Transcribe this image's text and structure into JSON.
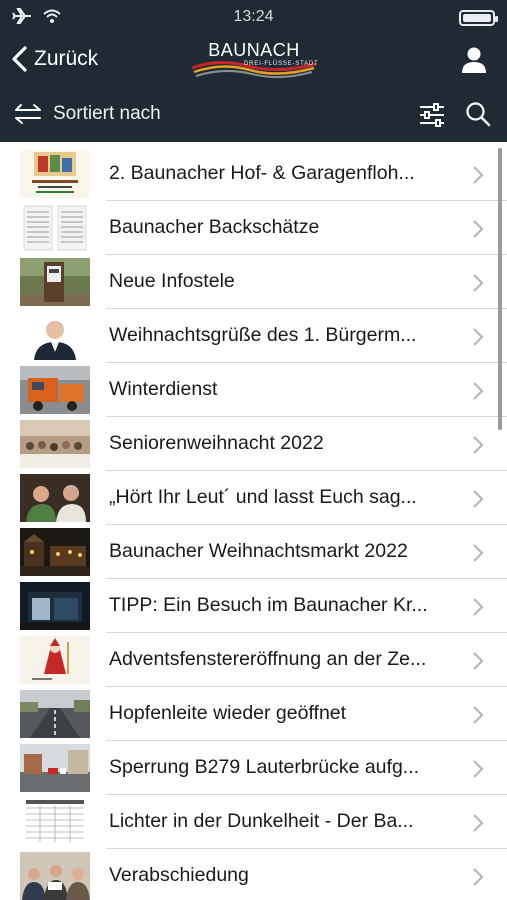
{
  "status_bar": {
    "time": "13:24"
  },
  "nav": {
    "back_label": "Zurück",
    "logo_name": "BAUNACH",
    "logo_tagline": "DREI-FLÜSSE-STADT"
  },
  "toolbar": {
    "sort_label": "Sortiert nach"
  },
  "colors": {
    "header_bg": "#1f2a35",
    "separator": "#d3d3d8",
    "chevron": "#b5b5bb"
  },
  "items": [
    {
      "title": "2. Baunacher Hof- & Garagenfloh...",
      "thumb": "flyer"
    },
    {
      "title": "Baunacher Backschätze",
      "thumb": "document"
    },
    {
      "title": "Neue Infostele",
      "thumb": "info-pillar"
    },
    {
      "title": "Weihnachtsgrüße des 1. Bürgerm...",
      "thumb": "portrait"
    },
    {
      "title": "Winterdienst",
      "thumb": "snow-plow"
    },
    {
      "title": "Seniorenweihnacht 2022",
      "thumb": "hall"
    },
    {
      "title": "„Hört Ihr Leut´ und lasst Euch sag...",
      "thumb": "two-men"
    },
    {
      "title": "Baunacher Weihnachtsmarkt 2022",
      "thumb": "night-market"
    },
    {
      "title": "TIPP: Ein Besuch im Baunacher Kr...",
      "thumb": "night-building"
    },
    {
      "title": "Adventsfenstereröffnung an der Ze...",
      "thumb": "advent-card"
    },
    {
      "title": "Hopfenleite wieder geöffnet",
      "thumb": "road"
    },
    {
      "title": "Sperrung B279 Lauterbrücke aufg...",
      "thumb": "street"
    },
    {
      "title": "Lichter in der Dunkelheit - Der Ba...",
      "thumb": "calendar"
    },
    {
      "title": "Verabschiedung",
      "thumb": "group"
    }
  ]
}
